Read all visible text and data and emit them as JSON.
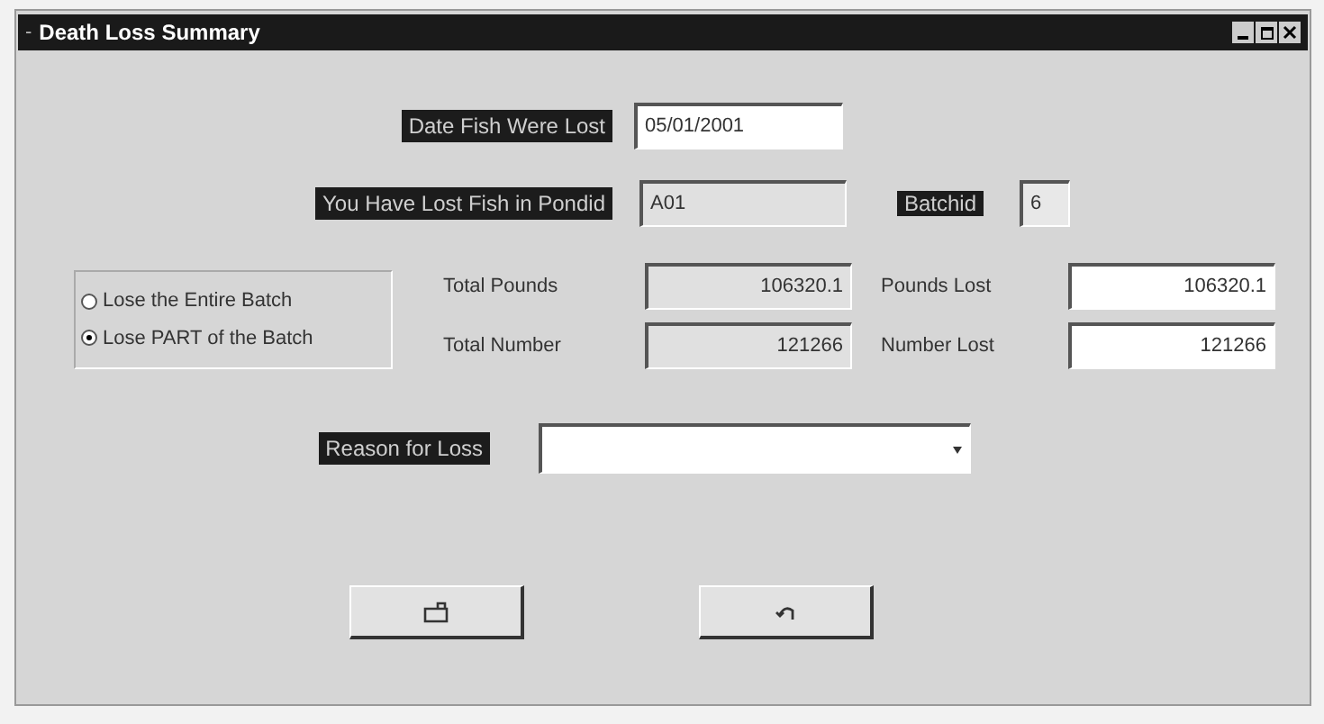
{
  "window": {
    "title": "Death Loss Summary",
    "control_icon": "-"
  },
  "date_field": {
    "label": "Date Fish Were Lost",
    "value": "05/01/2001"
  },
  "pond_field": {
    "label": "You Have Lost Fish in Pondid",
    "value": "A01"
  },
  "batch_field": {
    "label": "Batchid",
    "value": "6"
  },
  "loss_options": [
    {
      "label": "Lose the Entire Batch",
      "selected": false
    },
    {
      "label": "Lose PART of the Batch",
      "selected": true
    }
  ],
  "totals": [
    {
      "label": "Total Pounds",
      "value": "106320.1",
      "lost_label": "Pounds Lost",
      "lost_value": "106320.1"
    },
    {
      "label": "Total Number",
      "value": "121266",
      "lost_label": "Number Lost",
      "lost_value": "121266"
    }
  ],
  "reason": {
    "label": "Reason for Loss"
  },
  "buttons": [
    {
      "kind": "save"
    },
    {
      "kind": "undo"
    }
  ]
}
